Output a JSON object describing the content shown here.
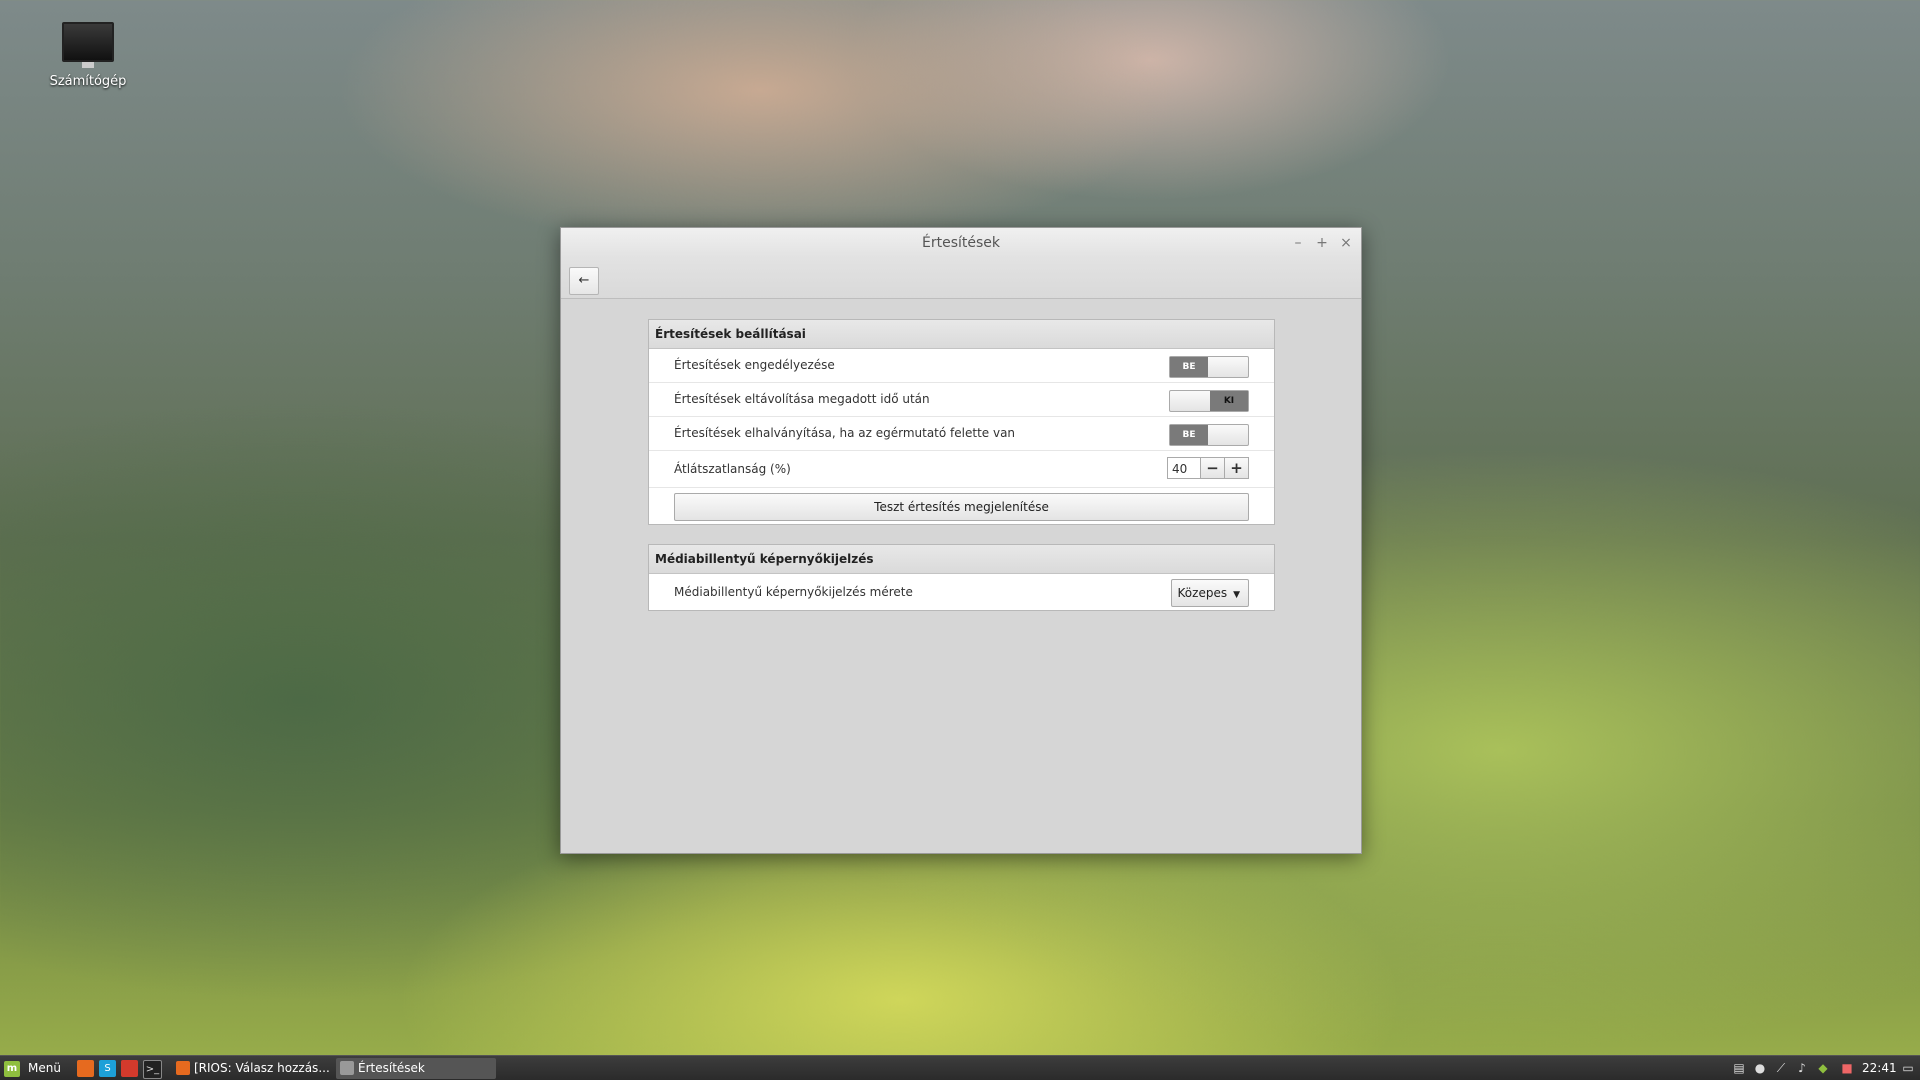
{
  "desktop": {
    "icons": [
      {
        "label": "Számítógép",
        "icon": "computer-icon"
      }
    ]
  },
  "window": {
    "title": "Értesítések",
    "controls": {
      "minimize": "–",
      "maximize": "+",
      "close": "×"
    },
    "back_icon": "←"
  },
  "section1": {
    "title": "Értesítések beállításai",
    "rows": [
      {
        "label": "Értesítések engedélyezése",
        "toggle": "BE",
        "state": "on"
      },
      {
        "label": "Értesítések eltávolítása megadott idő után",
        "toggle": "KI",
        "state": "off"
      },
      {
        "label": "Értesítések elhalványítása, ha az egérmutató felette van",
        "toggle": "BE",
        "state": "on"
      }
    ],
    "opacity": {
      "label": "Átlátszatlanság (%)",
      "value": "40",
      "minus": "−",
      "plus": "+"
    },
    "test_button": "Teszt értesítés megjelenítése"
  },
  "section2": {
    "title": "Médiabillentyű képernyőkijelzés",
    "row": {
      "label": "Médiabillentyű képernyőkijelzés mérete",
      "value": "Közepes"
    }
  },
  "taskbar": {
    "menu_label": "Menü",
    "tasks": [
      {
        "label": "[RIOS: Válasz hozzás...",
        "icon": "firefox-icon"
      },
      {
        "label": "Értesítések",
        "icon": "settings-icon",
        "active": true
      }
    ],
    "clock": "22:41"
  },
  "colors": {
    "toggle_knob": "#7a7a7a",
    "taskbar": "#2f2f2f",
    "mint_green": "#8fbf3f"
  }
}
